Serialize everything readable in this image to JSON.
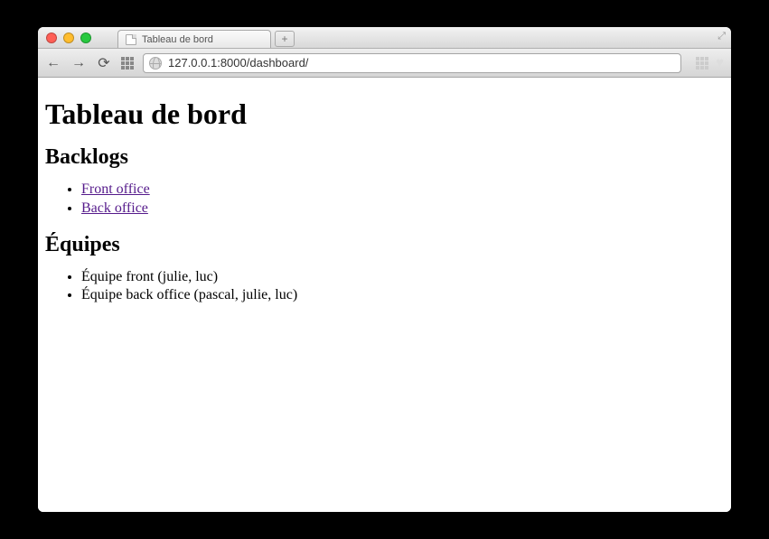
{
  "tab_title": "Tableau de bord",
  "url": "127.0.0.1:8000/dashboard/",
  "page": {
    "heading": "Tableau de bord",
    "backlogs_heading": "Backlogs",
    "backlogs": [
      "Front office",
      "Back office"
    ],
    "teams_heading": "Équipes",
    "teams": [
      "Équipe front (julie, luc)",
      "Équipe back office (pascal, julie, luc)"
    ]
  }
}
